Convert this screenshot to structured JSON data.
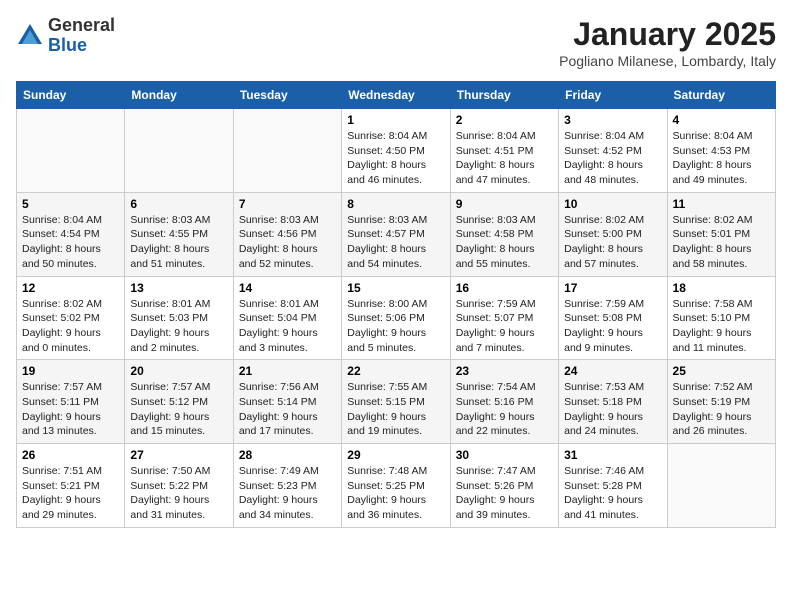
{
  "header": {
    "logo_general": "General",
    "logo_blue": "Blue",
    "month": "January 2025",
    "location": "Pogliano Milanese, Lombardy, Italy"
  },
  "weekdays": [
    "Sunday",
    "Monday",
    "Tuesday",
    "Wednesday",
    "Thursday",
    "Friday",
    "Saturday"
  ],
  "weeks": [
    [
      {
        "day": "",
        "info": ""
      },
      {
        "day": "",
        "info": ""
      },
      {
        "day": "",
        "info": ""
      },
      {
        "day": "1",
        "info": "Sunrise: 8:04 AM\nSunset: 4:50 PM\nDaylight: 8 hours and 46 minutes."
      },
      {
        "day": "2",
        "info": "Sunrise: 8:04 AM\nSunset: 4:51 PM\nDaylight: 8 hours and 47 minutes."
      },
      {
        "day": "3",
        "info": "Sunrise: 8:04 AM\nSunset: 4:52 PM\nDaylight: 8 hours and 48 minutes."
      },
      {
        "day": "4",
        "info": "Sunrise: 8:04 AM\nSunset: 4:53 PM\nDaylight: 8 hours and 49 minutes."
      }
    ],
    [
      {
        "day": "5",
        "info": "Sunrise: 8:04 AM\nSunset: 4:54 PM\nDaylight: 8 hours and 50 minutes."
      },
      {
        "day": "6",
        "info": "Sunrise: 8:03 AM\nSunset: 4:55 PM\nDaylight: 8 hours and 51 minutes."
      },
      {
        "day": "7",
        "info": "Sunrise: 8:03 AM\nSunset: 4:56 PM\nDaylight: 8 hours and 52 minutes."
      },
      {
        "day": "8",
        "info": "Sunrise: 8:03 AM\nSunset: 4:57 PM\nDaylight: 8 hours and 54 minutes."
      },
      {
        "day": "9",
        "info": "Sunrise: 8:03 AM\nSunset: 4:58 PM\nDaylight: 8 hours and 55 minutes."
      },
      {
        "day": "10",
        "info": "Sunrise: 8:02 AM\nSunset: 5:00 PM\nDaylight: 8 hours and 57 minutes."
      },
      {
        "day": "11",
        "info": "Sunrise: 8:02 AM\nSunset: 5:01 PM\nDaylight: 8 hours and 58 minutes."
      }
    ],
    [
      {
        "day": "12",
        "info": "Sunrise: 8:02 AM\nSunset: 5:02 PM\nDaylight: 9 hours and 0 minutes."
      },
      {
        "day": "13",
        "info": "Sunrise: 8:01 AM\nSunset: 5:03 PM\nDaylight: 9 hours and 2 minutes."
      },
      {
        "day": "14",
        "info": "Sunrise: 8:01 AM\nSunset: 5:04 PM\nDaylight: 9 hours and 3 minutes."
      },
      {
        "day": "15",
        "info": "Sunrise: 8:00 AM\nSunset: 5:06 PM\nDaylight: 9 hours and 5 minutes."
      },
      {
        "day": "16",
        "info": "Sunrise: 7:59 AM\nSunset: 5:07 PM\nDaylight: 9 hours and 7 minutes."
      },
      {
        "day": "17",
        "info": "Sunrise: 7:59 AM\nSunset: 5:08 PM\nDaylight: 9 hours and 9 minutes."
      },
      {
        "day": "18",
        "info": "Sunrise: 7:58 AM\nSunset: 5:10 PM\nDaylight: 9 hours and 11 minutes."
      }
    ],
    [
      {
        "day": "19",
        "info": "Sunrise: 7:57 AM\nSunset: 5:11 PM\nDaylight: 9 hours and 13 minutes."
      },
      {
        "day": "20",
        "info": "Sunrise: 7:57 AM\nSunset: 5:12 PM\nDaylight: 9 hours and 15 minutes."
      },
      {
        "day": "21",
        "info": "Sunrise: 7:56 AM\nSunset: 5:14 PM\nDaylight: 9 hours and 17 minutes."
      },
      {
        "day": "22",
        "info": "Sunrise: 7:55 AM\nSunset: 5:15 PM\nDaylight: 9 hours and 19 minutes."
      },
      {
        "day": "23",
        "info": "Sunrise: 7:54 AM\nSunset: 5:16 PM\nDaylight: 9 hours and 22 minutes."
      },
      {
        "day": "24",
        "info": "Sunrise: 7:53 AM\nSunset: 5:18 PM\nDaylight: 9 hours and 24 minutes."
      },
      {
        "day": "25",
        "info": "Sunrise: 7:52 AM\nSunset: 5:19 PM\nDaylight: 9 hours and 26 minutes."
      }
    ],
    [
      {
        "day": "26",
        "info": "Sunrise: 7:51 AM\nSunset: 5:21 PM\nDaylight: 9 hours and 29 minutes."
      },
      {
        "day": "27",
        "info": "Sunrise: 7:50 AM\nSunset: 5:22 PM\nDaylight: 9 hours and 31 minutes."
      },
      {
        "day": "28",
        "info": "Sunrise: 7:49 AM\nSunset: 5:23 PM\nDaylight: 9 hours and 34 minutes."
      },
      {
        "day": "29",
        "info": "Sunrise: 7:48 AM\nSunset: 5:25 PM\nDaylight: 9 hours and 36 minutes."
      },
      {
        "day": "30",
        "info": "Sunrise: 7:47 AM\nSunset: 5:26 PM\nDaylight: 9 hours and 39 minutes."
      },
      {
        "day": "31",
        "info": "Sunrise: 7:46 AM\nSunset: 5:28 PM\nDaylight: 9 hours and 41 minutes."
      },
      {
        "day": "",
        "info": ""
      }
    ]
  ]
}
